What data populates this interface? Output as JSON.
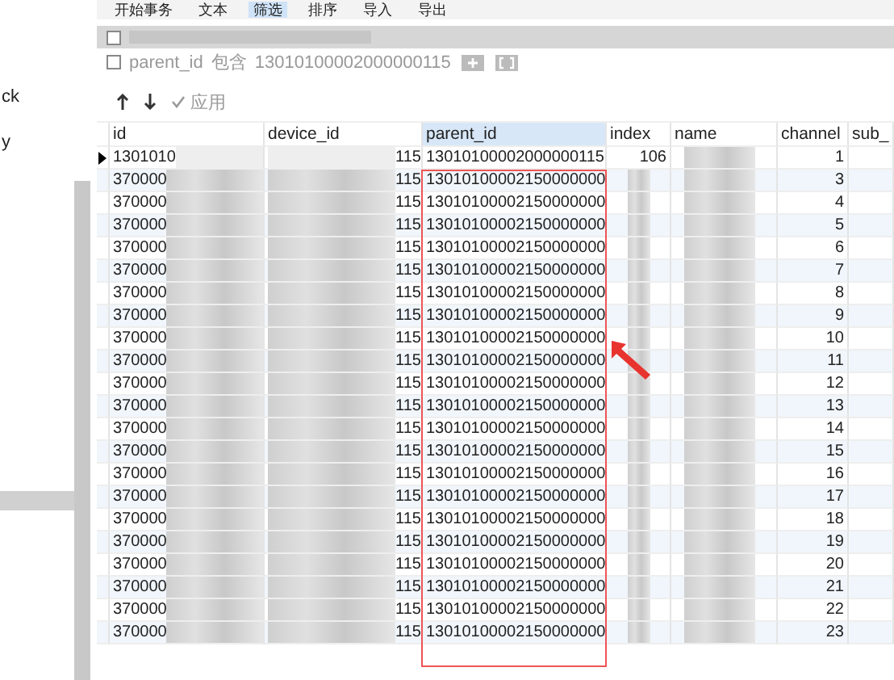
{
  "toolbar": [
    {
      "label": "开始事务",
      "selected": false
    },
    {
      "label": "文本",
      "selected": false
    },
    {
      "label": "筛选",
      "selected": true
    },
    {
      "label": "排序",
      "selected": false
    },
    {
      "label": "导入",
      "selected": false
    },
    {
      "label": "导出",
      "selected": false
    }
  ],
  "sidebar": {
    "items": [
      {
        "label": "ck",
        "selected": false
      },
      {
        "label": "y",
        "selected": false
      }
    ]
  },
  "filters": [
    {
      "kind": "redacted",
      "checked": false
    },
    {
      "kind": "text",
      "checked": false,
      "field": "parent_id",
      "operator": "包含",
      "value": "13010100002000000115"
    }
  ],
  "apply": {
    "label": "应用",
    "disabled": true
  },
  "table": {
    "columns": [
      {
        "label": "id",
        "selected": false
      },
      {
        "label": "device_id",
        "selected": false
      },
      {
        "label": "parent_id",
        "selected": true
      },
      {
        "label": "index",
        "selected": false
      },
      {
        "label": "name",
        "selected": false
      },
      {
        "label": "channel",
        "selected": false
      },
      {
        "label": "sub_",
        "selected": false
      }
    ],
    "rows": [
      {
        "selected": true,
        "id": "1301010",
        "device_id": "115",
        "parent_id": "13010100002000000115",
        "index": "106",
        "channel": "1"
      },
      {
        "selected": false,
        "id": "370000",
        "device_id": "115",
        "parent_id": "13010100002150000000",
        "channel": "3"
      },
      {
        "selected": false,
        "id": "370000",
        "device_id": "115",
        "parent_id": "13010100002150000000",
        "channel": "4"
      },
      {
        "selected": false,
        "id": "370000",
        "device_id": "115",
        "parent_id": "13010100002150000000",
        "channel": "5"
      },
      {
        "selected": false,
        "id": "370000",
        "device_id": "115",
        "parent_id": "13010100002150000000",
        "channel": "6"
      },
      {
        "selected": false,
        "id": "370000",
        "device_id": "115",
        "parent_id": "13010100002150000000",
        "channel": "7"
      },
      {
        "selected": false,
        "id": "370000",
        "device_id": "115",
        "parent_id": "13010100002150000000",
        "channel": "8"
      },
      {
        "selected": false,
        "id": "370000",
        "device_id": "115",
        "parent_id": "13010100002150000000",
        "channel": "9"
      },
      {
        "selected": false,
        "id": "370000",
        "device_id": "115",
        "parent_id": "13010100002150000000",
        "channel": "10"
      },
      {
        "selected": false,
        "id": "370000",
        "device_id": "115",
        "parent_id": "13010100002150000000",
        "channel": "11"
      },
      {
        "selected": false,
        "id": "370000",
        "device_id": "115",
        "parent_id": "13010100002150000000",
        "channel": "12"
      },
      {
        "selected": false,
        "id": "370000",
        "device_id": "115",
        "parent_id": "13010100002150000000",
        "channel": "13"
      },
      {
        "selected": false,
        "id": "370000",
        "device_id": "115",
        "parent_id": "13010100002150000000",
        "channel": "14"
      },
      {
        "selected": false,
        "id": "370000",
        "device_id": "115",
        "parent_id": "13010100002150000000",
        "channel": "15"
      },
      {
        "selected": false,
        "id": "370000",
        "device_id": "115",
        "parent_id": "13010100002150000000",
        "channel": "16"
      },
      {
        "selected": false,
        "id": "370000",
        "device_id": "115",
        "parent_id": "13010100002150000000",
        "channel": "17"
      },
      {
        "selected": false,
        "id": "370000",
        "device_id": "115",
        "parent_id": "13010100002150000000",
        "channel": "18"
      },
      {
        "selected": false,
        "id": "370000",
        "device_id": "115",
        "parent_id": "13010100002150000000",
        "channel": "19"
      },
      {
        "selected": false,
        "id": "370000",
        "device_id": "115",
        "parent_id": "13010100002150000000",
        "channel": "20"
      },
      {
        "selected": false,
        "id": "370000",
        "device_id": "115",
        "parent_id": "13010100002150000000",
        "channel": "21"
      },
      {
        "selected": false,
        "id": "370000",
        "device_id": "115",
        "parent_id": "13010100002150000000",
        "channel": "22"
      },
      {
        "selected": false,
        "id": "370000",
        "device_id": "115",
        "parent_id": "13010100002150000000",
        "channel": "23"
      }
    ]
  }
}
